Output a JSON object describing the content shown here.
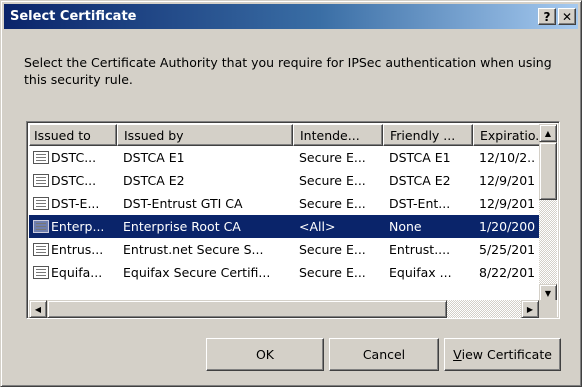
{
  "window": {
    "title": "Select Certificate",
    "help_btn": "?",
    "close_btn": "✕"
  },
  "instruction": "Select the Certificate Authority that you require for IPSec authentication when using this security rule.",
  "list": {
    "columns": [
      "Issued to",
      "Issued by",
      "Intende...",
      "Friendly ...",
      "Expiratio."
    ],
    "rows": [
      {
        "issued_to": "DSTC...",
        "issued_by": "DSTCA E1",
        "intended": "Secure E...",
        "friendly": "DSTCA E1",
        "expiration": "12/10/2..",
        "selected": false
      },
      {
        "issued_to": "DSTC...",
        "issued_by": "DSTCA E2",
        "intended": "Secure E...",
        "friendly": "DSTCA E2",
        "expiration": "12/9/201",
        "selected": false
      },
      {
        "issued_to": "DST-E...",
        "issued_by": "DST-Entrust GTI CA",
        "intended": "Secure E...",
        "friendly": "DST-Ent...",
        "expiration": "12/9/201",
        "selected": false
      },
      {
        "issued_to": "Enterp...",
        "issued_by": "Enterprise Root CA",
        "intended": "<All>",
        "friendly": "None",
        "expiration": "1/20/200",
        "selected": true
      },
      {
        "issued_to": "Entrus...",
        "issued_by": "Entrust.net Secure S...",
        "intended": "Secure E...",
        "friendly": "Entrust....",
        "expiration": "5/25/201",
        "selected": false
      },
      {
        "issued_to": "Equifa...",
        "issued_by": "Equifax Secure Certifi...",
        "intended": "Secure E...",
        "friendly": "Equifax ...",
        "expiration": "8/22/201",
        "selected": false
      }
    ]
  },
  "buttons": {
    "ok": "OK",
    "cancel": "Cancel",
    "view_mnemonic": "V",
    "view_rest": "iew Certificate"
  },
  "colors": {
    "title_active": "#0a246a",
    "selection": "#0a246a",
    "face": "#d4d0c8"
  }
}
